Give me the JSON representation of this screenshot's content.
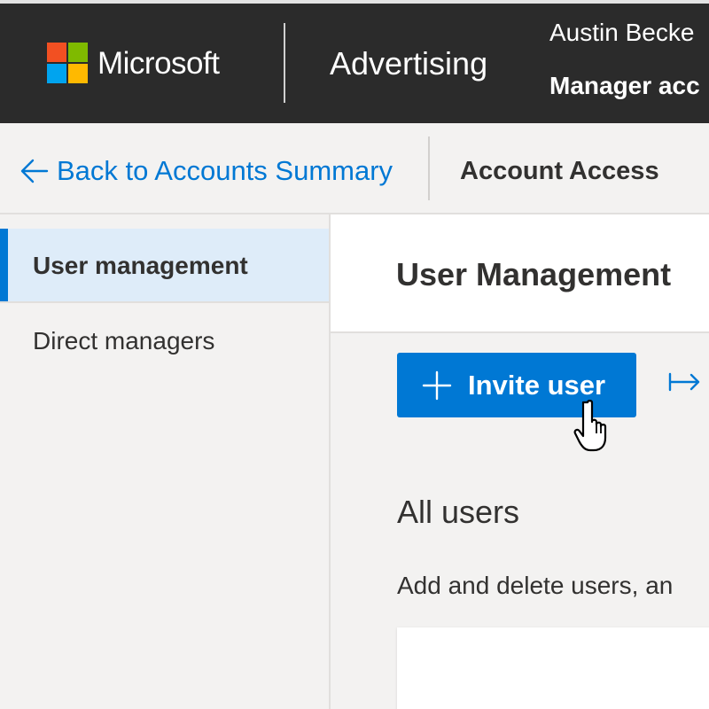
{
  "header": {
    "brand": "Microsoft",
    "product": "Advertising",
    "user_name": "Austin Becke",
    "account_type": "Manager acc",
    "logo_colors": [
      "#f25022",
      "#7fba00",
      "#00a4ef",
      "#ffb900"
    ]
  },
  "breadcrumb": {
    "back_icon": "arrow-left-icon",
    "back_label": "Back to Accounts Summary",
    "current": "Account Access"
  },
  "sidebar": {
    "items": [
      {
        "label": "User management",
        "active": true
      },
      {
        "label": "Direct managers",
        "active": false
      }
    ]
  },
  "main": {
    "title": "User Management",
    "invite_button": {
      "icon": "plus-icon",
      "label": "Invite user"
    },
    "secondary_action_icon": "arrow-right-bar-icon",
    "section_title": "All users",
    "section_desc": "Add and delete users, an"
  },
  "colors": {
    "accent": "#0078d4",
    "topbar": "#2b2b2b",
    "active_nav_bg": "#deecf9",
    "page_bg": "#f3f2f1"
  }
}
